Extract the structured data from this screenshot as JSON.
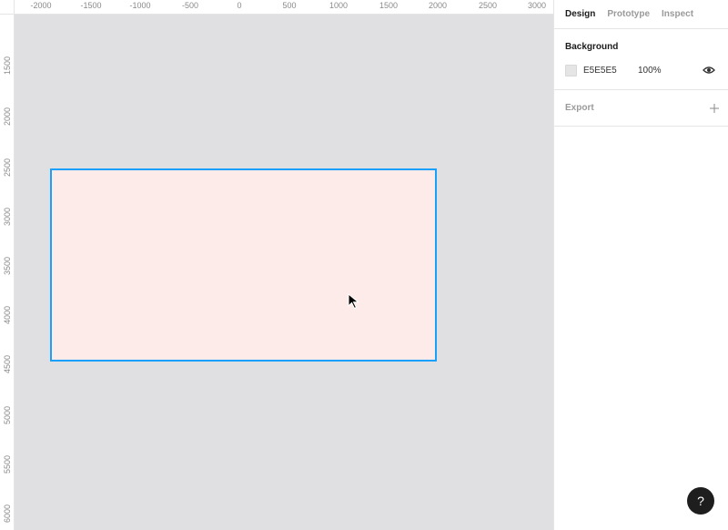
{
  "ruler": {
    "x_labels": [
      "-2000",
      "-1500",
      "-1000",
      "-500",
      "0",
      "500",
      "1000",
      "1500",
      "2000",
      "2500",
      "3000"
    ],
    "y_labels": [
      "1500",
      "2000",
      "2500",
      "3000",
      "3500",
      "4000",
      "4500",
      "5000",
      "5500",
      "6000"
    ]
  },
  "panel": {
    "tabs": [
      {
        "label": "Design",
        "active": true
      },
      {
        "label": "Prototype",
        "active": false
      },
      {
        "label": "Inspect",
        "active": false
      }
    ],
    "background": {
      "title": "Background",
      "color_hex": "E5E5E5",
      "opacity": "100%",
      "swatch_color": "#e5e5e5"
    },
    "export": {
      "label": "Export"
    }
  },
  "help": {
    "label": "?"
  },
  "colors": {
    "canvas": "#e0dfe1",
    "frame_fill": "#fcebe8",
    "selection": "#18a0fb"
  }
}
